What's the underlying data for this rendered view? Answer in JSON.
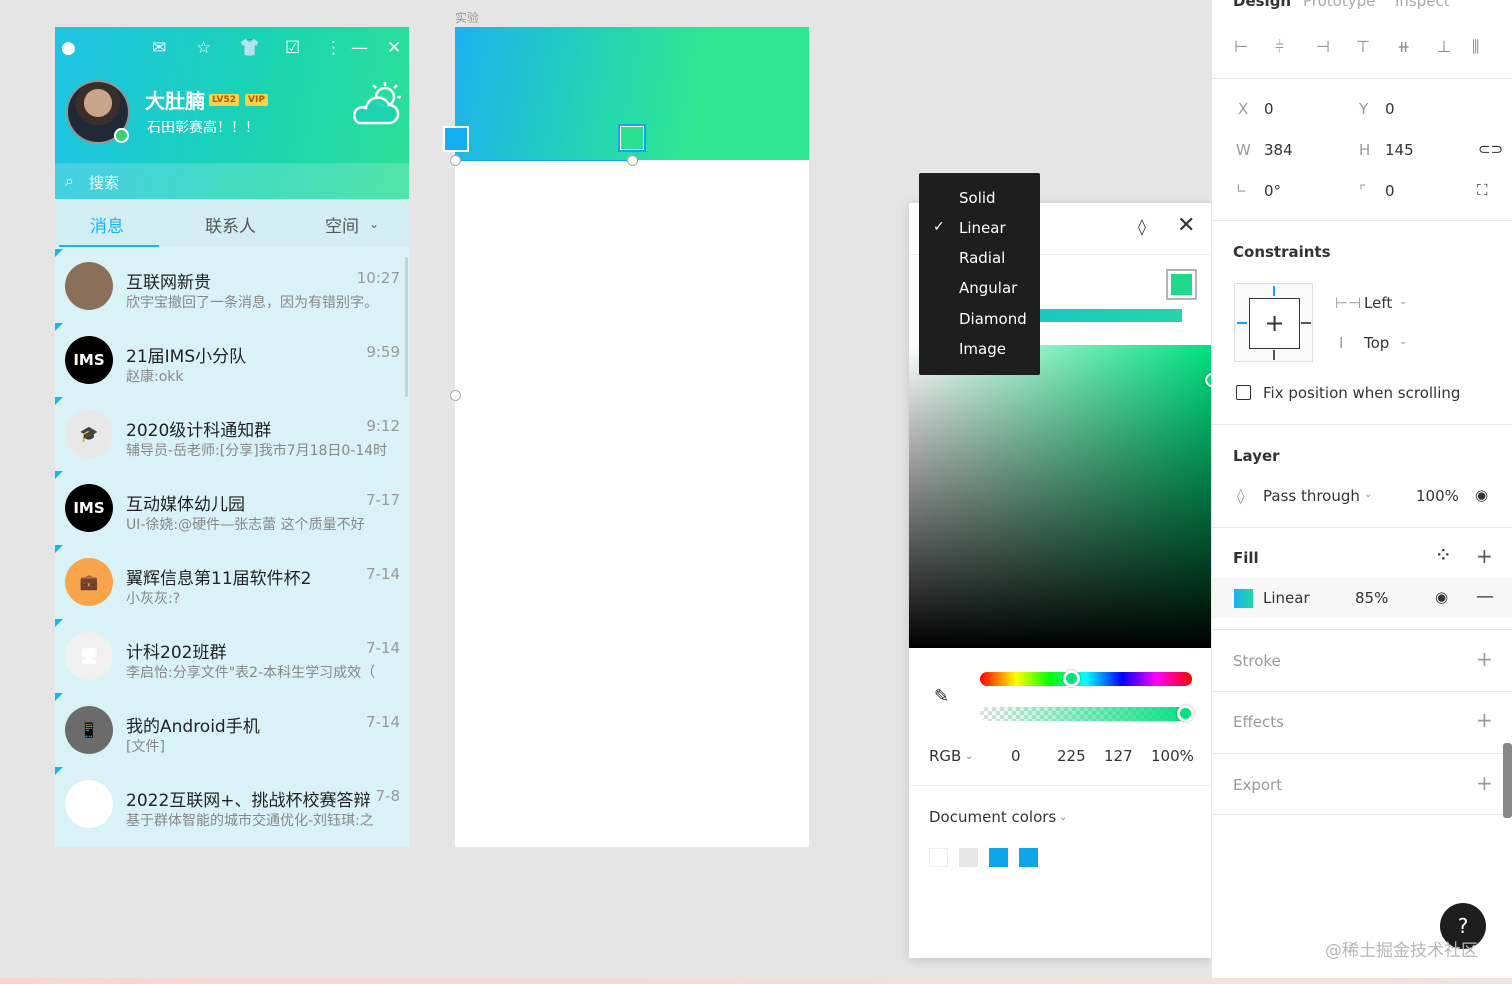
{
  "qq": {
    "nickname": "大肚腩",
    "level_badge": "LV52",
    "vip_badge": "VIP",
    "signature": "石田彰赛高！！！",
    "search_placeholder": "搜索",
    "tabs": [
      "消息",
      "联系人",
      "空间"
    ],
    "chats": [
      {
        "name": "互联网新贵",
        "message": "欣宇宝撤回了一条消息，因为有错别字。",
        "time": "10:27",
        "avatar_bg": "#8a6f5a",
        "avatar_text": ""
      },
      {
        "name": "21届IMS小分队",
        "message": "赵康:okk",
        "time": "9:59",
        "avatar_bg": "#000000",
        "avatar_text": "IMS"
      },
      {
        "name": "2020级计科通知群",
        "message": "辅导员-岳老师:[分享]我市7月18日0-14时",
        "time": "9:12",
        "avatar_bg": "#e8e8e8",
        "avatar_text": "🎓"
      },
      {
        "name": "互动媒体幼儿园",
        "message": "UI-徐娆:@硬件—张志蕾 这个质量不好",
        "time": "7-17",
        "avatar_bg": "#000000",
        "avatar_text": "IMS"
      },
      {
        "name": "翼辉信息第11届软件杯2",
        "message": "小灰灰:?",
        "time": "7-14",
        "avatar_bg": "#f7a44a",
        "avatar_text": "💼"
      },
      {
        "name": "计科202班群",
        "message": "李启怡:分享文件\"表2-本科生学习成效（",
        "time": "7-14",
        "avatar_bg": "#f0f0f0",
        "avatar_text": "🖥"
      },
      {
        "name": "我的Android手机",
        "message": "[文件]",
        "time": "7-14",
        "avatar_bg": "#6b6b6b",
        "avatar_text": "📱"
      },
      {
        "name": "2022互联网+、挑战杯校赛答辩",
        "message": "基于群体智能的城市交通优化-刘钰琪:之",
        "time": "7-8",
        "avatar_bg": "#ffffff",
        "avatar_text": ""
      }
    ]
  },
  "frame": {
    "label": "实验"
  },
  "fill_menu": {
    "items": [
      "Solid",
      "Linear",
      "Radial",
      "Angular",
      "Diamond",
      "Image"
    ],
    "selected": "Linear"
  },
  "picker": {
    "mode": "RGB",
    "r": "0",
    "g": "225",
    "b": "127",
    "alpha": "100%",
    "document_colors_label": "Document colors",
    "swatches": [
      "#ffffff",
      "#e6e6e6",
      "#0ea5e9",
      "#0ea5e9"
    ]
  },
  "panel": {
    "tabs": [
      "Design",
      "Prototype",
      "Inspect"
    ],
    "x_label": "X",
    "x": "0",
    "y_label": "Y",
    "y": "0",
    "w_label": "W",
    "w": "384",
    "h_label": "H",
    "h": "145",
    "rotation": "0°",
    "radius": "0",
    "constraints_title": "Constraints",
    "constraint_h": "Left",
    "constraint_v": "Top",
    "fix_scroll": "Fix position when scrolling",
    "layer_title": "Layer",
    "blend": "Pass through",
    "layer_opacity": "100%",
    "fill_title": "Fill",
    "fill_type": "Linear",
    "fill_opacity": "85%",
    "stroke_title": "Stroke",
    "effects_title": "Effects",
    "export_title": "Export",
    "help": "?"
  },
  "watermark": "@稀土掘金技术社区"
}
